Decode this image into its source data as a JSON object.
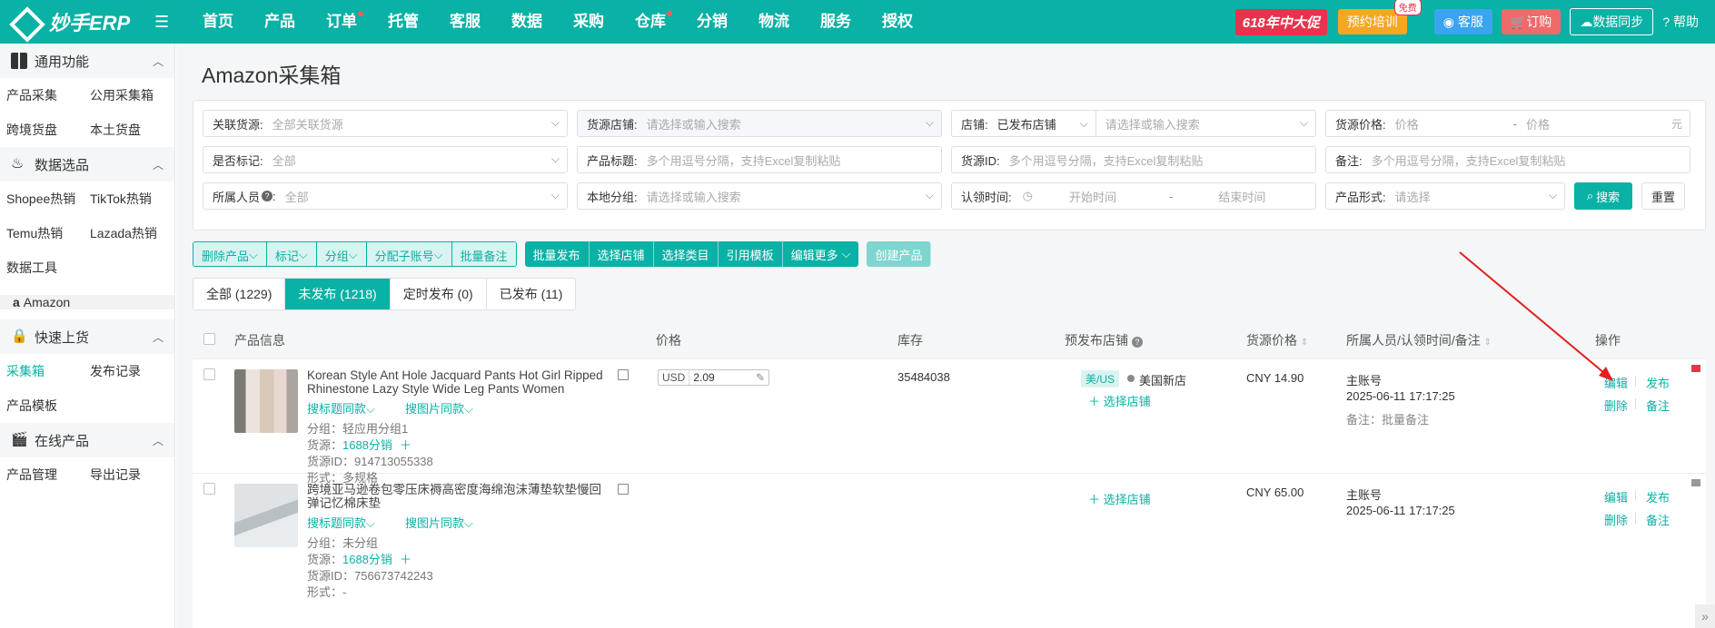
{
  "app": {
    "logo": "妙手ERP",
    "nav": [
      {
        "label": "首页"
      },
      {
        "label": "产品"
      },
      {
        "label": "订单",
        "dot": true
      },
      {
        "label": "托管"
      },
      {
        "label": "客服"
      },
      {
        "label": "数据"
      },
      {
        "label": "采购"
      },
      {
        "label": "仓库",
        "dot": true
      },
      {
        "label": "分销"
      },
      {
        "label": "物流"
      },
      {
        "label": "服务"
      },
      {
        "label": "授权"
      }
    ],
    "promo": "618年中大促",
    "training": "预约培训",
    "free_badge": "免费",
    "kefu": "客服",
    "order": "订购",
    "sync": "数据同步",
    "help": "帮助"
  },
  "sidebar": {
    "sections": [
      {
        "title": "通用功能",
        "rows": [
          [
            "产品采集",
            "公用采集箱"
          ],
          [
            "跨境货盘",
            "本土货盘"
          ]
        ]
      },
      {
        "title": "数据选品",
        "rows": [
          [
            "Shopee热销",
            "TikTok热销"
          ],
          [
            "Temu热销",
            "Lazada热销"
          ],
          [
            "数据工具"
          ],
          [
            "Amazon"
          ]
        ]
      },
      {
        "title": "快速上货",
        "rows": [
          [
            "采集箱",
            "发布记录"
          ],
          [
            "产品模板"
          ]
        ]
      },
      {
        "title": "在线产品",
        "rows": [
          [
            "产品管理",
            "导出记录"
          ]
        ]
      }
    ]
  },
  "page": {
    "title": "Amazon采集箱"
  },
  "filters": {
    "source_rel": {
      "label": "关联货源:",
      "ph": "全部关联货源"
    },
    "source_shop": {
      "label": "货源店铺:",
      "ph": "请选择或输入搜索"
    },
    "shop": {
      "label": "店铺:",
      "value": "已发布店铺",
      "ph": "请选择或输入搜索"
    },
    "price": {
      "label": "货源价格:",
      "ph1": "价格",
      "dash": "-",
      "ph2": "价格",
      "unit": "元"
    },
    "marked": {
      "label": "是否标记:",
      "value": "全部"
    },
    "ptitle": {
      "label": "产品标题:",
      "ph": "多个用逗号分隔，支持Excel复制粘贴"
    },
    "source_id": {
      "label": "货源ID:",
      "ph": "多个用逗号分隔，支持Excel复制粘贴"
    },
    "remark": {
      "label": "备注:",
      "ph": "多个用逗号分隔，支持Excel复制粘贴"
    },
    "owner": {
      "label": "所属人员",
      "value": "全部"
    },
    "group": {
      "label": "本地分组:",
      "ph": "请选择或输入搜索"
    },
    "claim_time": {
      "label": "认领时间:",
      "start": "开始时间",
      "dash": "-",
      "end": "结束时间"
    },
    "form": {
      "label": "产品形式:",
      "ph": "请选择"
    },
    "search": "搜索",
    "reset": "重置"
  },
  "actions": {
    "g1": [
      "删除产品",
      "标记",
      "分组",
      "分配子账号",
      "批量备注"
    ],
    "g2": [
      "批量发布",
      "选择店铺",
      "选择类目",
      "引用模板",
      "编辑更多"
    ],
    "create": "创建产品"
  },
  "tabs": [
    {
      "label": "全部 (1229)"
    },
    {
      "label": "未发布 (1218)",
      "active": true
    },
    {
      "label": "定时发布 (0)"
    },
    {
      "label": "已发布 (11)"
    }
  ],
  "table": {
    "headers": [
      "产品信息",
      "价格",
      "库存",
      "预发布店铺",
      "货源价格",
      "所属人员/认领时间/备注",
      "操作"
    ],
    "rows": [
      {
        "title": "Korean Style Ant Hole Jacquard Pants Hot Girl Ripped Rhinestone Lazy Style Wide Leg Pants Women Solid…",
        "search_title": "搜标题同款",
        "search_img": "搜图片同款",
        "group": "分组：轻应用分组1",
        "source_label": "货源：",
        "source": "1688分销",
        "source_id": "货源ID：914713055338",
        "form": "形式：多规格",
        "currency": "USD",
        "price": "2.09",
        "stock": "35484038",
        "region": "美/US",
        "shop": "美国新店",
        "choose_shop": "选择店铺",
        "src_price": "CNY 14.90",
        "owner": "主账号",
        "time": "2025-06-11 17:17:25",
        "remark": "备注：批量备注",
        "ops": [
          "编辑",
          "发布",
          "删除",
          "备注"
        ]
      },
      {
        "title": "跨境亚马逊卷包零压床褥高密度海绵泡沫薄垫软垫慢回弹记忆棉床垫",
        "search_title": "搜标题同款",
        "search_img": "搜图片同款",
        "group": "分组：未分组",
        "source_label": "货源：",
        "source": "1688分销",
        "source_id": "货源ID：756673742243",
        "form": "形式：-",
        "choose_shop": "选择店铺",
        "src_price": "CNY 65.00",
        "owner": "主账号",
        "time": "2025-06-11 17:17:25",
        "ops": [
          "编辑",
          "发布",
          "删除",
          "备注"
        ]
      }
    ]
  },
  "colors": {
    "brand": "#0ab1a5",
    "promo": "#e8334c",
    "arrow": "#e02020"
  }
}
